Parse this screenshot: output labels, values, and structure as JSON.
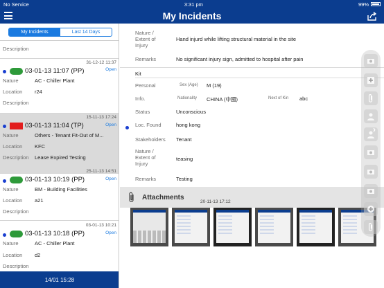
{
  "status_bar": {
    "carrier": "No Service",
    "time": "3:31 pm",
    "battery": "99%"
  },
  "nav": {
    "title": "My Incidents"
  },
  "segments": {
    "my_incidents": "My Incidents",
    "last_14_days": "Last 14 Days"
  },
  "labels": {
    "nature": "Nature",
    "location": "Location",
    "description": "Description"
  },
  "incidents": [
    {
      "description_only": "Description"
    },
    {
      "timestamp": "31-12-12 11:37",
      "status": "Open",
      "title": "03-01-13 11:07 (PP)",
      "nature": "AC - Chiller Plant",
      "location": "r24",
      "description": ""
    },
    {
      "timestamp": "15-11-13 17:24",
      "status": "Open",
      "title": "03-01-13 11:04 (TP)",
      "nature": "Others - Tenant Fit-Out of M...",
      "location": "KFC",
      "description": "Lease Expired Testing"
    },
    {
      "timestamp": "25-11-13 14:51",
      "status": "Open",
      "title": "03-01-13 10:19 (PP)",
      "nature": "BM - Building Facilities",
      "location": "a21",
      "description": ""
    },
    {
      "timestamp": "03-01-13 10:21",
      "status": "Open",
      "title": "03-01-13 10:18 (PP)",
      "nature": "AC - Chiller Plant",
      "location": "d2",
      "description": ""
    }
  ],
  "bottom_bar": {
    "text": "14/01 15:28"
  },
  "detail": {
    "nature_label": "Nature / Extent of Injury",
    "nature_value": "Hand injurd while lifting structural material in the site",
    "remarks_label": "Remarks",
    "remarks_value": "No significant injury sign, admitted to hospital after pain",
    "kit": "Kit",
    "personal_label": "Personal",
    "sex_age_label": "Sex (Age)",
    "sex_age_value": "M (19)",
    "info_label": "Info.",
    "nationality_label": "Nationality",
    "nationality_value": "CHINA (中國)",
    "next_of_kin_label": "Next of Kin",
    "next_of_kin_value": "abc",
    "status_label": "Status",
    "status_value": "Unconscious",
    "loc_found_label": "Loc. Found",
    "loc_found_value": "hong kong",
    "stakeholders_label": "Stakeholders",
    "stakeholders_value": "Tenant",
    "nature2_label": "Nature / Extent of Injury",
    "nature2_value": "teasing",
    "remarks2_label": "Remarks",
    "remarks2_value": "Testing"
  },
  "attachments": {
    "title": "Attachments",
    "date": "20-11-13 17:12"
  },
  "colors": {
    "nav": "#0b3d8f",
    "accent": "#1a7ae0",
    "open_green": "#2e9a3a",
    "urgent_red": "#e21d1d",
    "dot_blue": "#1a3fd0"
  },
  "icons": [
    "menu-icon",
    "share-icon",
    "paperclip-icon",
    "add-icon",
    "person-icon",
    "chevron-right-icon"
  ]
}
